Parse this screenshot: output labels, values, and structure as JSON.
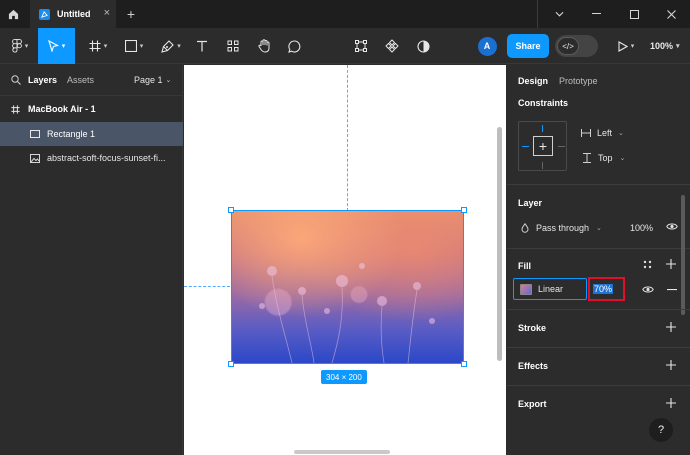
{
  "titlebar": {
    "file_title": "Untitled",
    "add_tab": "+",
    "close_tab": "×"
  },
  "toolbar": {
    "share_label": "Share",
    "avatar_initial": "A",
    "zoom_label": "100%",
    "devmode_glyph": "</>"
  },
  "left_panel": {
    "tabs": {
      "layers": "Layers",
      "assets": "Assets"
    },
    "page_selector": "Page 1",
    "layers": [
      {
        "name": "MacBook Air - 1",
        "type": "frame"
      },
      {
        "name": "Rectangle 1",
        "type": "rectangle",
        "selected": true
      },
      {
        "name": "abstract-soft-focus-sunset-fi...",
        "type": "image"
      }
    ]
  },
  "canvas": {
    "selection_size": "304 × 200"
  },
  "right_panel": {
    "tabs": {
      "design": "Design",
      "prototype": "Prototype"
    },
    "constraints": {
      "title": "Constraints",
      "horizontal": "Left",
      "vertical": "Top"
    },
    "layer": {
      "title": "Layer",
      "blend_mode": "Pass through",
      "opacity": "100%"
    },
    "fill": {
      "title": "Fill",
      "type": "Linear",
      "opacity": "70%"
    },
    "stroke": {
      "title": "Stroke"
    },
    "effects": {
      "title": "Effects"
    },
    "export": {
      "title": "Export"
    },
    "help": "?"
  },
  "colors": {
    "accent": "#0d99ff",
    "highlight_box": "#e0102a",
    "panel_bg": "#2c2c2c",
    "titlebar_bg": "#1e1e1e"
  }
}
